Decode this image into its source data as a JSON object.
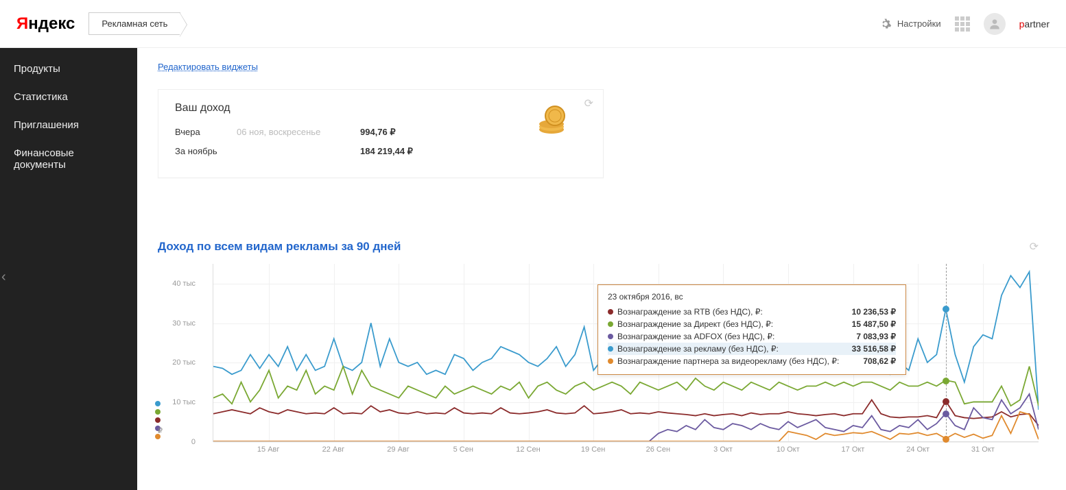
{
  "header": {
    "logo_y": "Я",
    "logo_rest": "ндекс",
    "product": "Рекламная сеть",
    "settings": "Настройки",
    "username_p": "p",
    "username_rest": "artner"
  },
  "sidebar": {
    "items": [
      "Продукты",
      "Статистика",
      "Приглашения",
      "Финансовые документы"
    ]
  },
  "main": {
    "edit_widgets": "Редактировать виджеты"
  },
  "income_widget": {
    "title": "Ваш доход",
    "rows": [
      {
        "label": "Вчера",
        "sub": "06 ноя, воскресенье",
        "val": "994,76 ₽"
      },
      {
        "label": "За ноябрь",
        "sub": "",
        "val": "184 219,44 ₽"
      }
    ]
  },
  "chart_widget": {
    "title": "Доход по всем видам рекламы за 90 дней",
    "tooltip": {
      "date": "23 октября 2016, вс",
      "rows": [
        {
          "color": "#8b2b2b",
          "name": "Вознаграждение за RTB (без НДС), ₽:",
          "val": "10 236,53 ₽"
        },
        {
          "color": "#7aa833",
          "name": "Вознаграждение за Директ (без НДС), ₽:",
          "val": "15 487,50 ₽"
        },
        {
          "color": "#6b5aa0",
          "name": "Вознаграждение за ADFOX (без НДС), ₽:",
          "val": "7 083,93 ₽"
        },
        {
          "color": "#3a9bcd",
          "name": "Вознаграждение за рекламу (без НДС), ₽:",
          "val": "33 516,58 ₽",
          "highlighted": true
        },
        {
          "color": "#e08a2e",
          "name": "Вознаграждение партнера за видеорекламу (без НДС), ₽:",
          "val": "708,62 ₽"
        }
      ]
    }
  },
  "chart_data": {
    "type": "line",
    "title": "Доход по всем видам рекламы за 90 дней",
    "xlabel": "",
    "ylabel": "₽",
    "ylim": [
      0,
      45000
    ],
    "y_ticks": [
      0,
      10000,
      20000,
      30000,
      40000
    ],
    "y_tick_labels": [
      "0",
      "10 тыс",
      "20 тыс",
      "30 тыс",
      "40 тыс"
    ],
    "x_tick_labels": [
      "15 Авг",
      "22 Авг",
      "29 Авг",
      "5 Сен",
      "12 Сен",
      "19 Сен",
      "26 Сен",
      "3 Окт",
      "10 Окт",
      "17 Окт",
      "24 Окт",
      "31 Окт"
    ],
    "series": [
      {
        "name": "Вознаграждение за рекламу (без НДС)",
        "color": "#3a9bcd",
        "values": [
          19000,
          18500,
          17000,
          18000,
          22000,
          18500,
          22000,
          19000,
          24000,
          18000,
          22000,
          18000,
          19000,
          26000,
          19000,
          18000,
          20000,
          30000,
          19000,
          26000,
          20000,
          19000,
          20000,
          17000,
          18000,
          17000,
          22000,
          21000,
          18000,
          20000,
          21000,
          24000,
          23000,
          22000,
          20000,
          19000,
          21000,
          24000,
          19000,
          22000,
          29000,
          18000,
          21000,
          22000,
          26000,
          30000,
          23000,
          20000,
          22000,
          21000,
          22000,
          21000,
          22500,
          20000,
          22000,
          24000,
          21000,
          27000,
          19000,
          26000,
          20000,
          21000,
          29000,
          21000,
          19000,
          20000,
          19000,
          21000,
          22000,
          21000,
          22000,
          33000,
          20000,
          17000,
          20000,
          18000,
          26000,
          20000,
          22000,
          33517,
          22000,
          15000,
          24000,
          27000,
          26000,
          37000,
          42000,
          39000,
          43000,
          8000
        ]
      },
      {
        "name": "Вознаграждение за Директ (без НДС)",
        "color": "#7aa833",
        "values": [
          11000,
          12000,
          9500,
          15000,
          10000,
          13000,
          18000,
          11000,
          14000,
          13000,
          18000,
          12000,
          14000,
          13000,
          19000,
          12000,
          18000,
          14000,
          13000,
          12000,
          11000,
          14000,
          13000,
          12000,
          11000,
          14000,
          12000,
          13000,
          14000,
          13000,
          12000,
          14000,
          13000,
          15000,
          11000,
          14000,
          15000,
          13000,
          12000,
          14000,
          15000,
          13000,
          14000,
          15000,
          14000,
          12000,
          15000,
          14000,
          13000,
          14000,
          15000,
          13000,
          16000,
          14000,
          13000,
          15000,
          14000,
          13000,
          15000,
          14000,
          13000,
          15000,
          14000,
          13000,
          14000,
          14000,
          15000,
          14000,
          15000,
          14000,
          15000,
          15000,
          14000,
          13000,
          15000,
          14000,
          14000,
          15000,
          14000,
          15488,
          15000,
          9500,
          10000,
          10000,
          10000,
          14000,
          9000,
          10500,
          19000,
          9000
        ]
      },
      {
        "name": "Вознаграждение за RTB (без НДС)",
        "color": "#8b2b2b",
        "values": [
          7000,
          7500,
          8000,
          7500,
          7000,
          8500,
          7500,
          7000,
          8000,
          7500,
          7000,
          7200,
          7000,
          8500,
          7000,
          7200,
          7000,
          9000,
          7500,
          8000,
          7200,
          7000,
          7500,
          7000,
          7200,
          7000,
          8500,
          7200,
          7000,
          7200,
          7000,
          8500,
          7200,
          7000,
          7200,
          7500,
          8000,
          7200,
          7000,
          7200,
          9000,
          7000,
          7200,
          7500,
          8000,
          7000,
          7200,
          7000,
          7500,
          7200,
          7000,
          6800,
          6500,
          7000,
          6500,
          6800,
          7000,
          6500,
          7200,
          6800,
          7000,
          7000,
          7500,
          7000,
          6800,
          6500,
          6800,
          7000,
          6500,
          7000,
          7000,
          10500,
          7000,
          6200,
          6000,
          6200,
          6200,
          6500,
          6000,
          10237,
          6500,
          6000,
          5800,
          6000,
          6200,
          7500,
          6200,
          6800,
          7000,
          4000
        ]
      },
      {
        "name": "Вознаграждение за ADFOX (без НДС)",
        "color": "#6b5aa0",
        "values": [
          0,
          0,
          0,
          0,
          0,
          0,
          0,
          0,
          0,
          0,
          0,
          0,
          0,
          0,
          0,
          0,
          0,
          0,
          0,
          0,
          0,
          0,
          0,
          0,
          0,
          0,
          0,
          0,
          0,
          0,
          0,
          0,
          0,
          0,
          0,
          0,
          0,
          0,
          0,
          0,
          0,
          0,
          0,
          0,
          0,
          0,
          0,
          0,
          2000,
          3000,
          2500,
          4000,
          3000,
          5500,
          3500,
          3000,
          4500,
          4000,
          3000,
          4500,
          3500,
          3000,
          5000,
          3500,
          4500,
          5500,
          3500,
          3000,
          2500,
          4000,
          3500,
          6500,
          3000,
          2500,
          4000,
          3500,
          5500,
          3000,
          4500,
          7084,
          4000,
          3000,
          8500,
          6000,
          5500,
          10500,
          7000,
          8500,
          12000,
          3000
        ]
      },
      {
        "name": "Вознаграждение партнера за видеорекламу (без НДС)",
        "color": "#e08a2e",
        "values": [
          0,
          0,
          0,
          0,
          0,
          0,
          0,
          0,
          0,
          0,
          0,
          0,
          0,
          0,
          0,
          0,
          0,
          0,
          0,
          0,
          0,
          0,
          0,
          0,
          0,
          0,
          0,
          0,
          0,
          0,
          0,
          0,
          0,
          0,
          0,
          0,
          0,
          0,
          0,
          0,
          0,
          0,
          0,
          0,
          0,
          0,
          0,
          0,
          0,
          0,
          0,
          0,
          0,
          0,
          0,
          0,
          0,
          0,
          0,
          0,
          0,
          0,
          2500,
          2000,
          1500,
          500,
          2000,
          1500,
          1800,
          2200,
          2000,
          2500,
          1500,
          500,
          2000,
          1800,
          2200,
          1500,
          2000,
          709,
          2000,
          1000,
          1800,
          800,
          1500,
          6500,
          2000,
          7500,
          6800,
          500
        ]
      }
    ],
    "hover_index": 79
  }
}
